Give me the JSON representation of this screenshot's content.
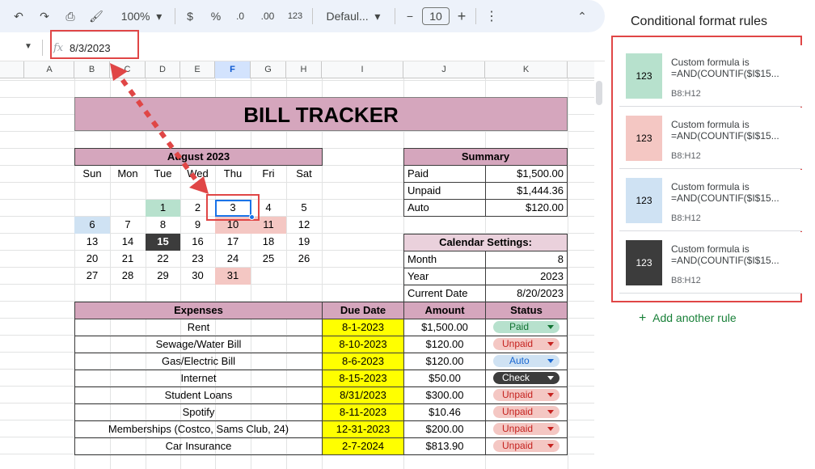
{
  "toolbar": {
    "zoom": "100%",
    "currency": "$",
    "percent": "%",
    "dec_dec": ".0",
    "dec_inc": ".00",
    "num_fmt": "123",
    "font": "Defaul...",
    "font_size": "10"
  },
  "formula_bar": {
    "value": "8/3/2023",
    "fx": "fx"
  },
  "columns": [
    "A",
    "B",
    "C",
    "D",
    "E",
    "F",
    "G",
    "H",
    "I",
    "J",
    "K"
  ],
  "sheet": {
    "title": "BILL TRACKER",
    "calendar_month": "August  2023",
    "weekdays": [
      "Sun",
      "Mon",
      "Tue",
      "Wed",
      "Thu",
      "Fri",
      "Sat"
    ],
    "summary": {
      "header": "Summary",
      "rows": [
        [
          "Paid",
          "$1,500.00"
        ],
        [
          "Unpaid",
          "$1,444.36"
        ],
        [
          "Auto",
          "$120.00"
        ]
      ]
    },
    "settings": {
      "header": "Calendar Settings:",
      "rows": [
        [
          "Month",
          "8"
        ],
        [
          "Year",
          "2023"
        ],
        [
          "Current Date",
          "8/20/2023"
        ]
      ]
    },
    "expenses_headers": [
      "Expenses",
      "Due Date",
      "Amount",
      "Status"
    ],
    "expenses": [
      [
        "Rent",
        "8-1-2023",
        "$1,500.00",
        "Paid"
      ],
      [
        "Sewage/Water Bill",
        "8-10-2023",
        "$120.00",
        "Unpaid"
      ],
      [
        "Gas/Electric Bill",
        "8-6-2023",
        "$120.00",
        "Auto"
      ],
      [
        "Internet",
        "8-15-2023",
        "$50.00",
        "Check"
      ],
      [
        "Student Loans",
        "8/31/2023",
        "$300.00",
        "Unpaid"
      ],
      [
        "Spotify",
        "8-11-2023",
        "$10.46",
        "Unpaid"
      ],
      [
        "Memberships (Costco, Sams Club, 24)",
        "12-31-2023",
        "$200.00",
        "Unpaid"
      ],
      [
        "Car Insurance",
        "2-7-2024",
        "$813.90",
        "Unpaid"
      ]
    ]
  },
  "panel": {
    "title": "Conditional format rules",
    "add_rule": "Add another rule",
    "rules": [
      {
        "line1": "Custom formula is",
        "line2": "=AND(COUNTIF($I$15...",
        "range": "B8:H12",
        "swatch": "123",
        "bg": "#b7e1cd",
        "fg": "#000000"
      },
      {
        "line1": "Custom formula is",
        "line2": "=AND(COUNTIF($I$15...",
        "range": "B8:H12",
        "swatch": "123",
        "bg": "#f4c7c3",
        "fg": "#000000"
      },
      {
        "line1": "Custom formula is",
        "line2": "=AND(COUNTIF($I$15...",
        "range": "B8:H12",
        "swatch": "123",
        "bg": "#cfe2f3",
        "fg": "#000000"
      },
      {
        "line1": "Custom formula is",
        "line2": "=AND(COUNTIF($I$15...",
        "range": "B8:H12",
        "swatch": "123",
        "bg": "#3c3c3c",
        "fg": "#ffffff"
      }
    ]
  },
  "colors": {
    "paid": "#b7e1cd",
    "unpaid": "#f4c7c3",
    "auto": "#cfe2f3",
    "check": "#3c3c3c",
    "accent": "#e04646",
    "header": "#d5a6bd",
    "due": "#ffff00"
  }
}
